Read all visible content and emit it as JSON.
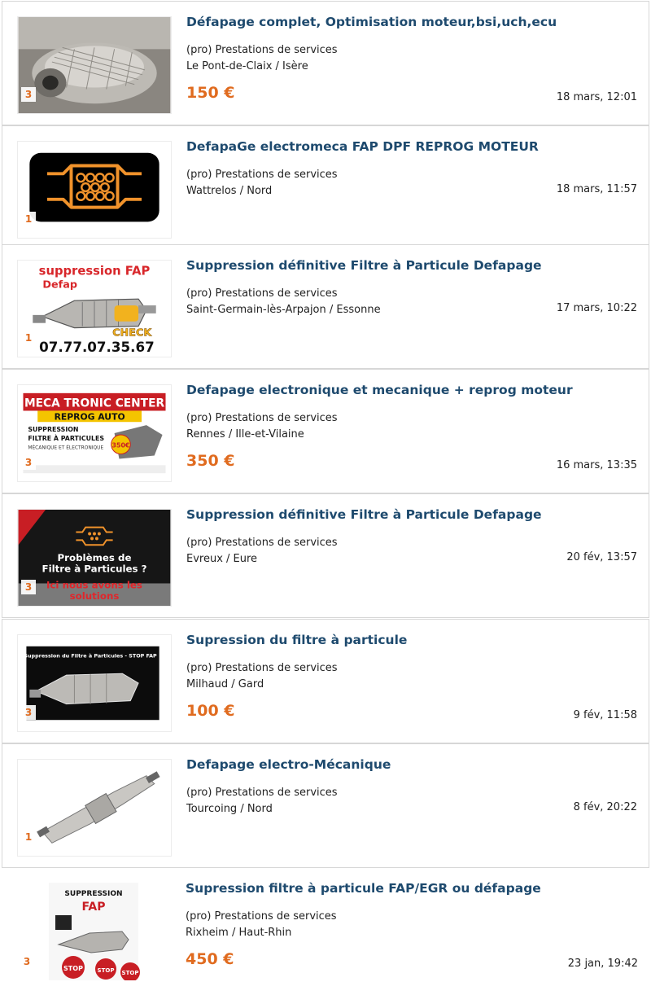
{
  "listings": [
    {
      "title": "Défapage complet, Optimisation moteur,bsi,uch,ecu",
      "category": "(pro) Prestations de services",
      "location": "Le Pont-de-Claix / Isère",
      "price": "150 €",
      "date": "18 mars, 12:01",
      "photo_count": "3"
    },
    {
      "title": "DefapaGe electromeca FAP DPF REPROG MOTEUR",
      "category": "(pro) Prestations de services",
      "location": "Wattrelos / Nord",
      "price": "",
      "date": "18 mars, 11:57",
      "photo_count": "1"
    },
    {
      "title": "Suppression définitive Filtre à Particule Defapage",
      "category": "(pro) Prestations de services",
      "location": "Saint-Germain-lès-Arpajon / Essonne",
      "price": "",
      "date": "17 mars, 10:22",
      "photo_count": "1",
      "image_text": [
        "suppression FAP",
        "Defap",
        "CHECK",
        "07.77.07.35.67"
      ]
    },
    {
      "title": "Defapage electronique et mecanique + reprog moteur",
      "category": "(pro) Prestations de services",
      "location": "Rennes / Ille-et-Vilaine",
      "price": "350 €",
      "date": "16 mars, 13:35",
      "photo_count": "3",
      "image_text": [
        "MECA TRONIC CENTER",
        "REPROG AUTO",
        "SUPPRESSION",
        "FILTRE À PARTICULES",
        "MÉCANIQUE ET ÉLECTRONIQUE",
        "350€"
      ]
    },
    {
      "title": "Suppression définitive Filtre à Particule Defapage",
      "category": "(pro) Prestations de services",
      "location": "Evreux / Eure",
      "price": "",
      "date": "20 fév, 13:57",
      "photo_count": "3",
      "image_text": [
        "Problèmes de",
        "Filtre à Particules ?",
        "Ici nous avons les",
        "solutions"
      ]
    },
    {
      "title": "Supression du filtre à particule",
      "category": "(pro) Prestations de services",
      "location": "Milhaud / Gard",
      "price": "100 €",
      "date": "9 fév, 11:58",
      "photo_count": "3",
      "image_text": [
        "Suppression du Filtre à Particules - STOP FAP"
      ]
    },
    {
      "title": "Defapage electro-Mécanique",
      "category": "(pro) Prestations de services",
      "location": "Tourcoing / Nord",
      "price": "",
      "date": "8 fév, 20:22",
      "photo_count": "1"
    },
    {
      "title": "Supression filtre à particule FAP/EGR ou défapage",
      "category": "(pro) Prestations de services",
      "location": "Rixheim / Haut-Rhin",
      "price": "450 €",
      "date": "23 jan, 19:42",
      "photo_count": "3",
      "image_text": [
        "SUPPRESSION",
        "FAP",
        "STOP"
      ]
    }
  ],
  "colors": {
    "title": "#1e4a6e",
    "price": "#e06b1f",
    "border": "#d7d7d7"
  }
}
